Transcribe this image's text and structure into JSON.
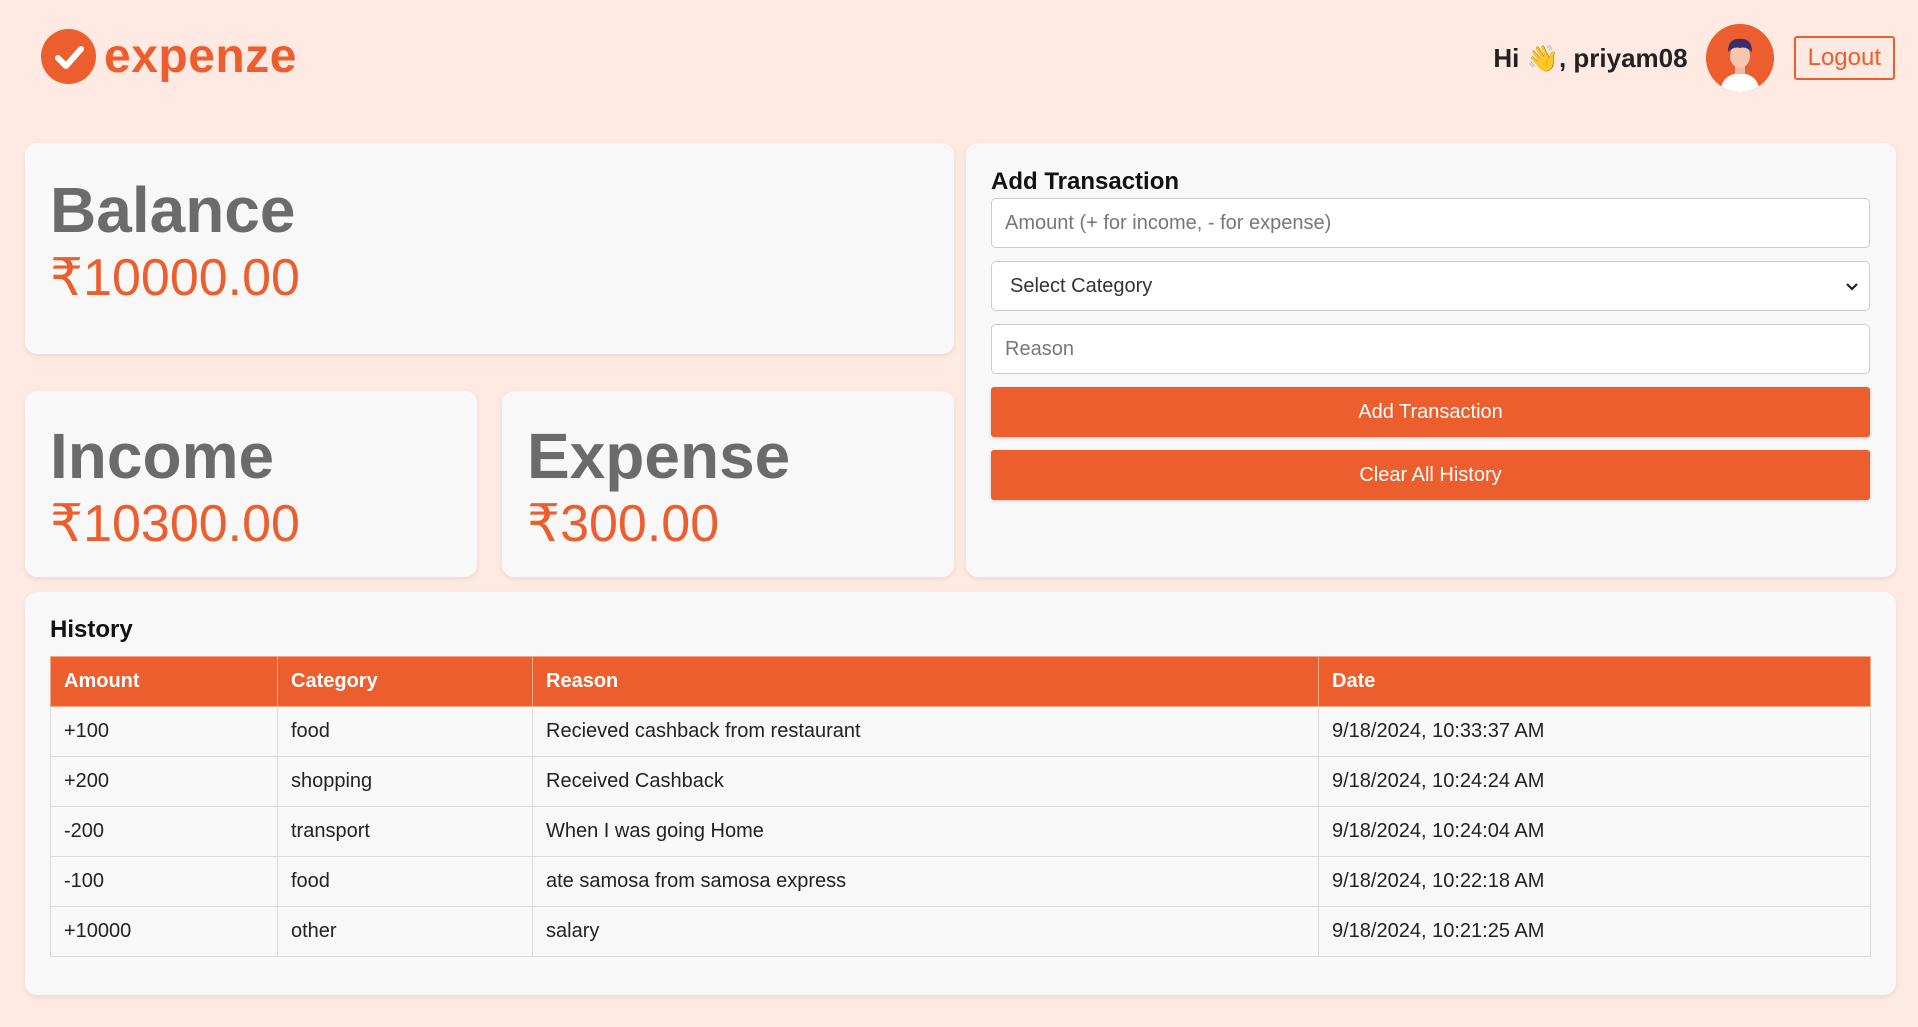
{
  "header": {
    "logo_text": "expenze",
    "greeting": "Hi 👋, priyam08",
    "logout_label": "Logout"
  },
  "balance": {
    "title": "Balance",
    "value": "₹10000.00"
  },
  "income": {
    "title": "Income",
    "value": "₹10300.00"
  },
  "expense": {
    "title": "Expense",
    "value": "₹300.00"
  },
  "form": {
    "title": "Add Transaction",
    "amount_placeholder": "Amount (+ for income, - for expense)",
    "category_selected": "Select Category",
    "reason_placeholder": "Reason",
    "add_label": "Add Transaction",
    "clear_label": "Clear All History"
  },
  "history": {
    "title": "History",
    "columns": [
      "Amount",
      "Category",
      "Reason",
      "Date"
    ],
    "rows": [
      {
        "amount": "+100",
        "category": "food",
        "reason": "Recieved cashback from restaurant",
        "date": "9/18/2024, 10:33:37 AM"
      },
      {
        "amount": "+200",
        "category": "shopping",
        "reason": "Received Cashback",
        "date": "9/18/2024, 10:24:24 AM"
      },
      {
        "amount": "-200",
        "category": "transport",
        "reason": "When I was going Home",
        "date": "9/18/2024, 10:24:04 AM"
      },
      {
        "amount": "-100",
        "category": "food",
        "reason": "ate samosa from samosa express",
        "date": "9/18/2024, 10:22:18 AM"
      },
      {
        "amount": "+10000",
        "category": "other",
        "reason": "salary",
        "date": "9/18/2024, 10:21:25 AM"
      }
    ]
  },
  "colors": {
    "accent": "#ec5e2d",
    "background": "#ffe9e3",
    "card": "#f8f8f8"
  },
  "icons": {
    "logo": "check-circle-icon",
    "avatar": "user-avatar",
    "dropdown": "chevron-down-icon"
  }
}
